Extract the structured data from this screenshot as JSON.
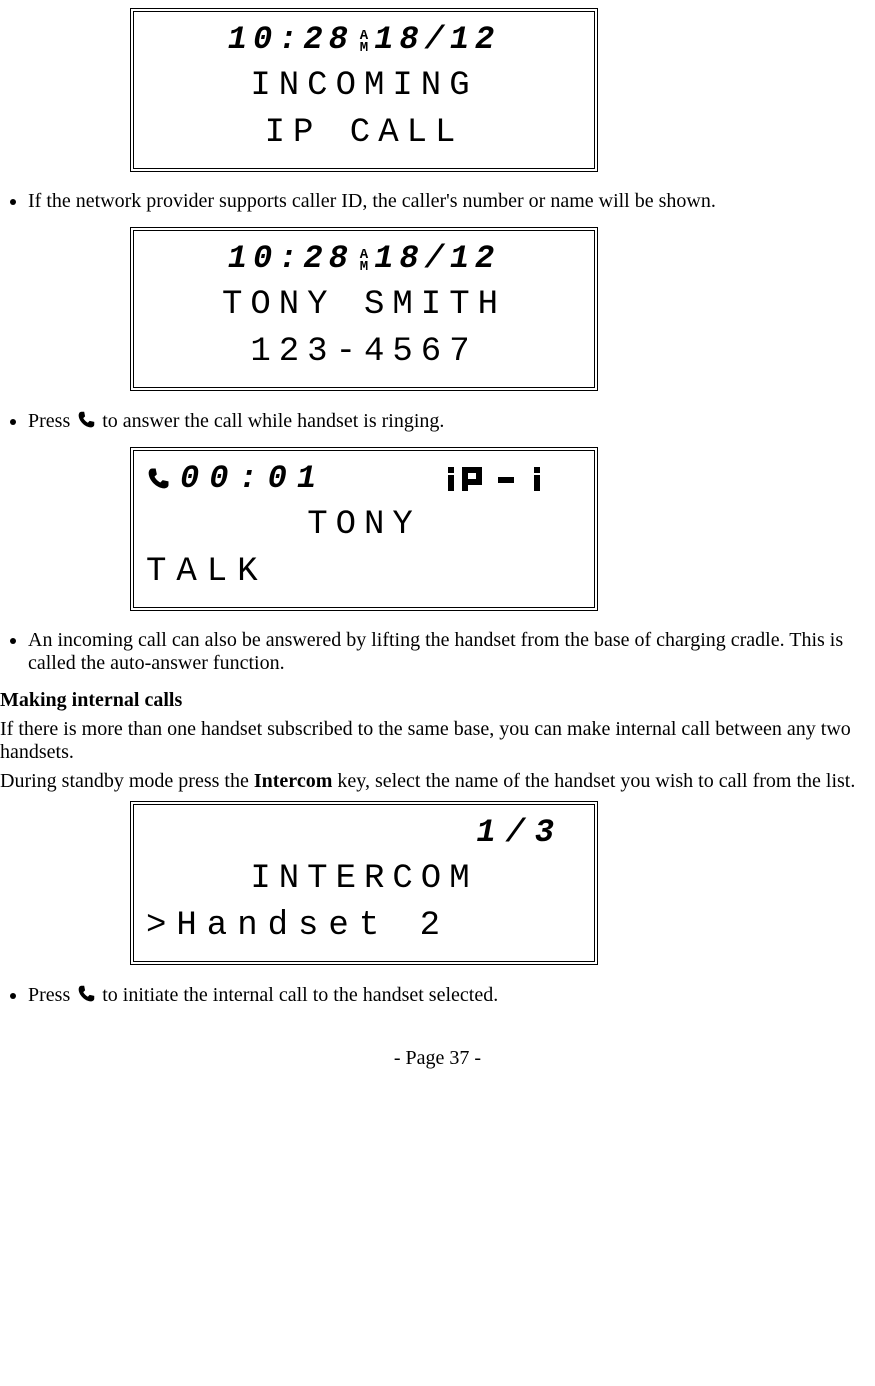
{
  "lcd1": {
    "time": "10:28",
    "ampm_top": "A",
    "ampm_bot": "M",
    "date": "18/12",
    "line2": "INCOMING",
    "line3": "IP CALL"
  },
  "bullet1": "If the network provider supports caller ID, the caller's number or name will be shown.",
  "lcd2": {
    "time": "10:28",
    "ampm_top": "A",
    "ampm_bot": "M",
    "date": "18/12",
    "line2": "TONY SMITH",
    "line3": "123-4567"
  },
  "bullet2_a": "Press ",
  "bullet2_b": " to answer the call while handset is ringing.",
  "lcd3": {
    "elapsed": "00:01",
    "line2": "TONY",
    "line3": "TALK"
  },
  "bullet3": "An incoming call can also be answered by lifting the handset from the base of charging cradle. This is called the auto-answer function.",
  "heading": "Making internal calls",
  "para1": "If there is more than one handset subscribed to the same base, you can make internal call between any two handsets.",
  "para2_a": "During standby mode press the ",
  "para2_bold": "Intercom",
  "para2_b": " key, select the name of the handset you wish to call from the list.",
  "lcd4": {
    "counter": "1/3",
    "line2": "INTERCOM",
    "line3": ">Handset 2"
  },
  "bullet4_a": "Press ",
  "bullet4_b": " to initiate the internal call to the handset selected.",
  "footer": "- Page 37 -"
}
